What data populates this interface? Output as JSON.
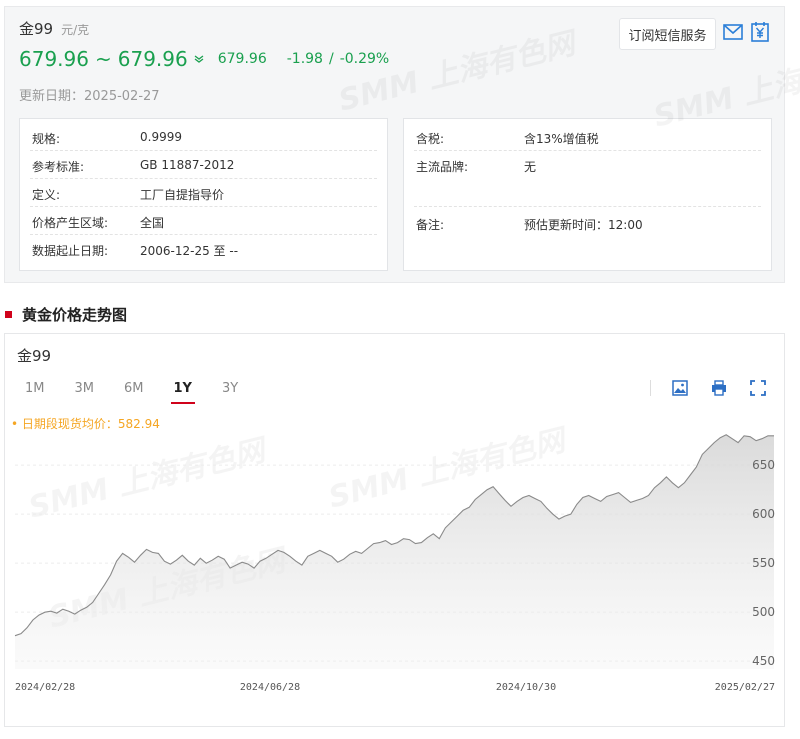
{
  "product": {
    "name": "金99",
    "unit": "元/克"
  },
  "price": {
    "low": "679.96",
    "sep": "~",
    "high": "679.96",
    "avg": "679.96",
    "change": "-1.98",
    "divider": "/",
    "change_pct": "-0.29%"
  },
  "update_label": "更新日期：2025-02-27",
  "subscribe_label": "订阅短信服务",
  "icons": {
    "mail": "mail-icon",
    "yuan": "yuan-icon",
    "down": "double-chevron-down-icon",
    "image": "image-icon",
    "print": "print-icon",
    "fullscreen": "fullscreen-icon"
  },
  "info_left": [
    {
      "label": "规格:",
      "value": "0.9999"
    },
    {
      "label": "参考标准:",
      "value": "GB 11887-2012"
    },
    {
      "label": "定义:",
      "value": "工厂自提指导价"
    },
    {
      "label": "价格产生区域:",
      "value": "全国"
    },
    {
      "label": "数据起止日期:",
      "value": "2006-12-25 至 --"
    }
  ],
  "info_right": [
    {
      "label": "含税:",
      "value": "含13%增值税"
    },
    {
      "label": "主流品牌:",
      "value": "无"
    },
    {
      "label": "备注:",
      "value": "预估更新时间：12:00"
    }
  ],
  "section_title": "黄金价格走势图",
  "chart_title": "金99",
  "tabs": [
    {
      "label": "1M",
      "active": false
    },
    {
      "label": "3M",
      "active": false
    },
    {
      "label": "6M",
      "active": false
    },
    {
      "label": "1Y",
      "active": true
    },
    {
      "label": "3Y",
      "active": false
    }
  ],
  "avg_label": "• 日期段现货均价：582.94",
  "watermark": "SMM 上海有色网",
  "colors": {
    "green": "#1aa04f",
    "red": "#d0021b",
    "orange": "#f5a623",
    "line": "#8a8a8a"
  },
  "chart_data": {
    "type": "area",
    "x_labels": [
      "2024/02/28",
      "2024/06/28",
      "2024/10/30",
      "2025/02/27"
    ],
    "y_ticks": [
      450,
      500,
      550,
      600,
      650
    ],
    "ylim": [
      442,
      692
    ],
    "values": [
      476,
      478,
      484,
      492,
      497,
      500,
      501,
      499,
      503,
      501,
      498,
      502,
      505,
      510,
      519,
      528,
      538,
      552,
      560,
      556,
      551,
      558,
      564,
      561,
      560,
      552,
      549,
      553,
      558,
      552,
      548,
      555,
      550,
      553,
      557,
      554,
      545,
      548,
      551,
      549,
      545,
      552,
      555,
      559,
      563,
      561,
      557,
      552,
      548,
      557,
      560,
      563,
      560,
      557,
      551,
      554,
      559,
      562,
      560,
      565,
      570,
      571,
      573,
      569,
      571,
      575,
      574,
      570,
      571,
      576,
      580,
      575,
      586,
      592,
      598,
      604,
      607,
      615,
      620,
      625,
      628,
      621,
      614,
      608,
      613,
      617,
      619,
      616,
      613,
      606,
      600,
      595,
      598,
      600,
      610,
      617,
      619,
      616,
      613,
      618,
      620,
      622,
      617,
      612,
      614,
      616,
      619,
      627,
      632,
      638,
      632,
      627,
      632,
      640,
      648,
      661,
      667,
      673,
      678,
      681,
      677,
      673,
      680,
      679,
      675,
      677,
      680,
      679.96
    ]
  }
}
